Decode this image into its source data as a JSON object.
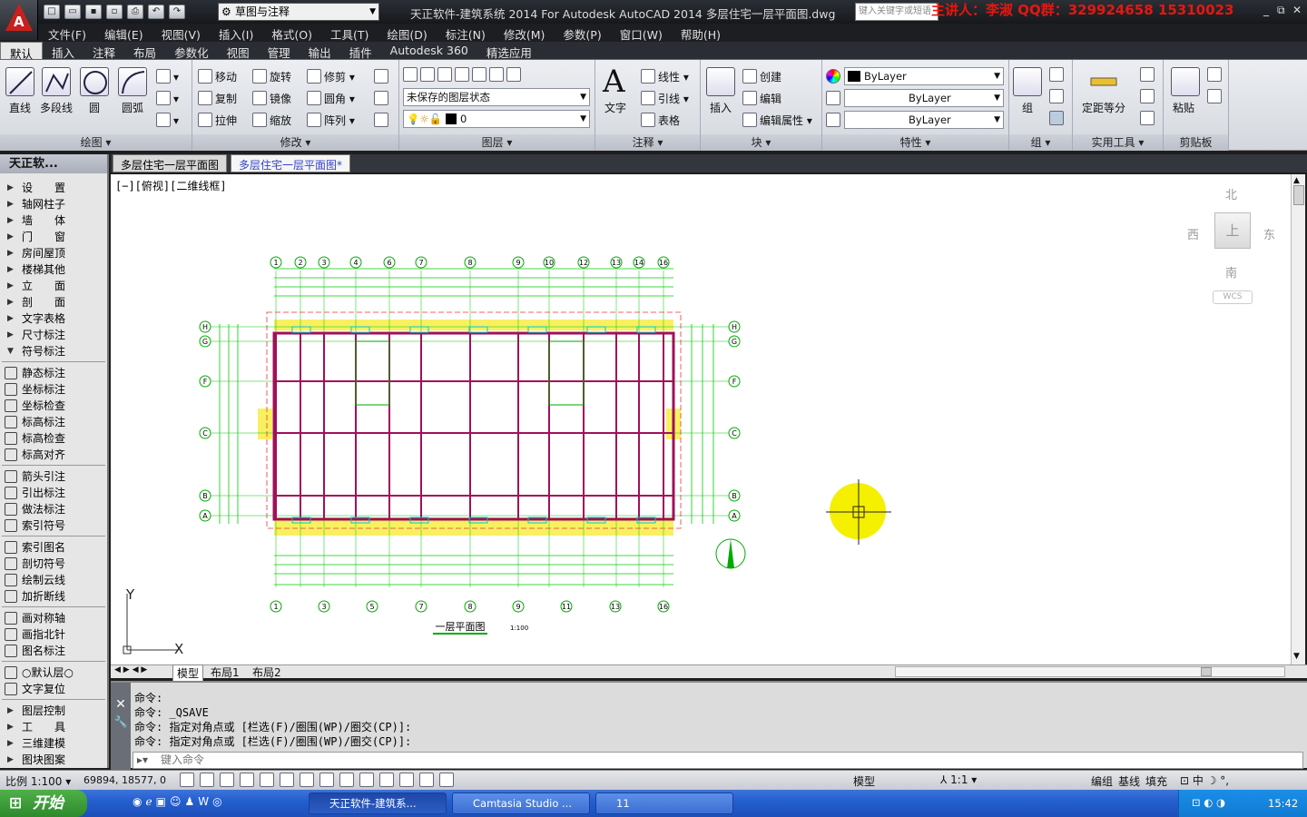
{
  "window": {
    "title": "天正软件-建筑系统 2014  For Autodesk AutoCAD 2014    多层住宅一层平面图.dwg",
    "search_placeholder": "键入关键字或短语",
    "watermark": "主讲人：李淑    QQ群：329924658   15310023",
    "controls": [
      "_",
      "⧉",
      "✕"
    ]
  },
  "workspace": "草图与注释",
  "menu": [
    "文件(F)",
    "编辑(E)",
    "视图(V)",
    "插入(I)",
    "格式(O)",
    "工具(T)",
    "绘图(D)",
    "标注(N)",
    "修改(M)",
    "参数(P)",
    "窗口(W)",
    "帮助(H)"
  ],
  "ribbon_tabs": [
    "默认",
    "插入",
    "注释",
    "布局",
    "参数化",
    "视图",
    "管理",
    "输出",
    "插件",
    "Autodesk 360",
    "精选应用"
  ],
  "ribbon": {
    "draw": {
      "title": "绘图",
      "items": [
        "直线",
        "多段线",
        "圆",
        "圆弧"
      ]
    },
    "modify": {
      "title": "修改",
      "items": [
        "移动",
        "旋转",
        "修剪",
        "复制",
        "镜像",
        "圆角",
        "拉伸",
        "缩放",
        "阵列"
      ]
    },
    "layer": {
      "title": "图层",
      "state": "未保存的图层状态",
      "current": "0"
    },
    "annotation": {
      "title": "注释",
      "big": "文字",
      "items": [
        "线性",
        "引线",
        "表格"
      ]
    },
    "block": {
      "title": "块",
      "big": "插入",
      "items": [
        "创建",
        "编辑",
        "编辑属性"
      ]
    },
    "properties": {
      "title": "特性",
      "color": "ByLayer",
      "linetype": "ByLayer",
      "lineweight": "ByLayer"
    },
    "group": {
      "title": "组",
      "big": "组"
    },
    "utilities": {
      "title": "实用工具",
      "big": "定距等分"
    },
    "clipboard": {
      "title": "剪贴板",
      "big": "粘贴"
    }
  },
  "doc_tabs": [
    "多层住宅一层平面图",
    "多层住宅一层平面图*"
  ],
  "left_panel": {
    "title": "天正软...",
    "groups": [
      [
        "设　　置",
        "轴网柱子",
        "墙　　体",
        "门　　窗",
        "房间屋顶",
        "楼梯其他",
        "立　　面",
        "剖　　面",
        "文字表格",
        "尺寸标注",
        "符号标注"
      ],
      [
        "静态标注",
        "坐标标注",
        "坐标检查",
        "标高标注",
        "标高检查",
        "标高对齐"
      ],
      [
        "箭头引注",
        "引出标注",
        "做法标注",
        "索引符号"
      ],
      [
        "索引图名",
        "剖切符号",
        "绘制云线",
        "加折断线"
      ],
      [
        "画对称轴",
        "画指北针",
        "图名标注"
      ],
      [
        "○默认层○",
        "文字复位"
      ],
      [
        "图层控制",
        "工　　具",
        "三维建模",
        "图块图案"
      ]
    ]
  },
  "viewport": {
    "label": "[−][俯视][二维线框]",
    "viewcube": {
      "north": "北",
      "south": "南",
      "east": "东",
      "west": "西",
      "top": "上",
      "wcs": "WCS"
    },
    "axes_top": [
      "1",
      "2",
      "3",
      "4",
      "6",
      "7",
      "8",
      "9",
      "10",
      "12",
      "13",
      "14",
      "16"
    ],
    "axes_bottom": [
      "1",
      "3",
      "5",
      "7",
      "8",
      "9",
      "11",
      "13",
      "16"
    ],
    "axes_side": [
      "H",
      "G",
      "F",
      "C",
      "B",
      "A"
    ],
    "plan_title": "一层平面图",
    "plan_scale": "1:100",
    "ucs_x": "X",
    "ucs_y": "Y"
  },
  "layout_tabs": [
    "模型",
    "布局1",
    "布局2"
  ],
  "command": {
    "lines": [
      "命令:",
      "命令: _QSAVE",
      "命令: 指定对角点或 [栏选(F)/圈围(WP)/圈交(CP)]:",
      "命令: 指定对角点或 [栏选(F)/圈围(WP)/圈交(CP)]:"
    ],
    "placeholder": "键入命令"
  },
  "status": {
    "scale": "比例 1:100",
    "coords": "69894, 18577, 0",
    "model": "模型",
    "anno": "1:1",
    "items": [
      "编组",
      "基线",
      "填充"
    ]
  },
  "taskbar": {
    "start": "开始",
    "tasks": [
      "天正软件-建筑系...",
      "Camtasia Studio ...",
      "11"
    ],
    "time": "15:42"
  }
}
